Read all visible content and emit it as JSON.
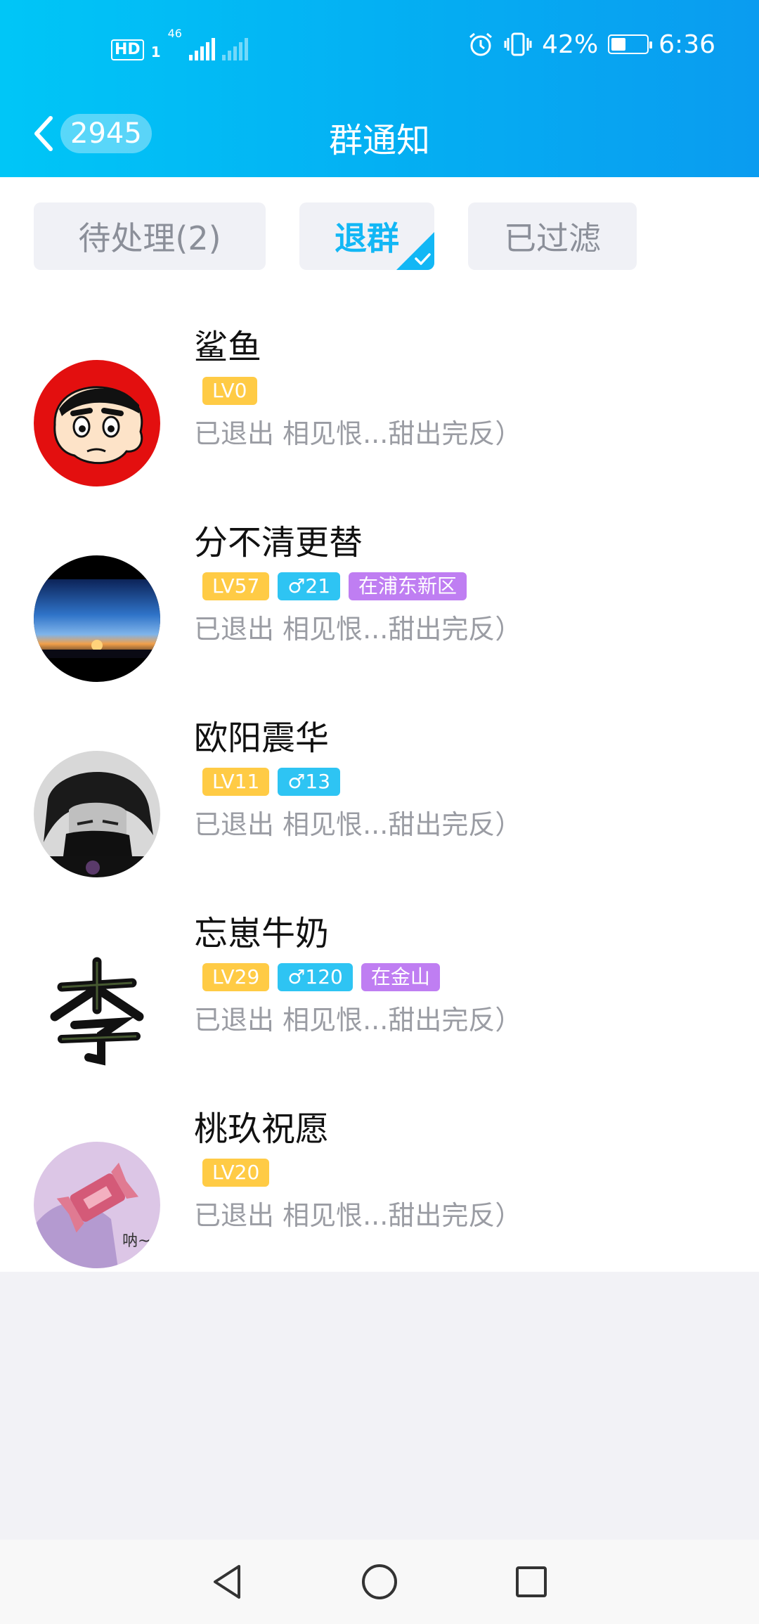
{
  "status_bar": {
    "hd_label": "HD",
    "sim_label": "1",
    "net_label": "46",
    "battery_percent": "42%",
    "battery_level": 0.42,
    "time": "6:36"
  },
  "nav": {
    "back_count": "2945",
    "title": "群通知"
  },
  "tabs": [
    {
      "label": "待处理(2)",
      "active": false
    },
    {
      "label": "退群",
      "active": true
    },
    {
      "label": "已过滤",
      "active": false
    }
  ],
  "items": [
    {
      "name": "鲨鱼",
      "level": "LV0",
      "gender": "",
      "location": "",
      "status": "已退出 相见恨...甜出完反）",
      "avatar": "crayon-shin-chan-avatar"
    },
    {
      "name": "分不清更替",
      "level": "LV57",
      "gender": "♂21",
      "location": "在浦东新区",
      "status": "已退出 相见恨...甜出完反）",
      "avatar": "sunset-avatar"
    },
    {
      "name": "欧阳震华",
      "level": "LV11",
      "gender": "♂13",
      "location": "",
      "status": "已退出 相见恨...甜出完反）",
      "avatar": "anime-boy-avatar"
    },
    {
      "name": "忘崽牛奶",
      "level": "LV29",
      "gender": "♂120",
      "location": "在金山",
      "status": "已退出 相见恨...甜出完反）",
      "avatar": "li-calligraphy-avatar"
    },
    {
      "name": "桃玖祝愿",
      "level": "LV20",
      "gender": "",
      "location": "",
      "status": "已退出 相见恨...甜出完反）",
      "avatar": "candy-avatar",
      "avatar_text": "呐~"
    }
  ],
  "colors": {
    "accent": "#12b7f5",
    "header_start": "#00c6f7",
    "header_end": "#0a9cf0",
    "level_badge": "#ffcb45",
    "gender_badge": "#2ec4f3",
    "location_badge": "#bf7ef2"
  },
  "system_nav": {
    "icons": [
      "back-triangle-icon",
      "home-circle-icon",
      "recents-square-icon"
    ]
  }
}
